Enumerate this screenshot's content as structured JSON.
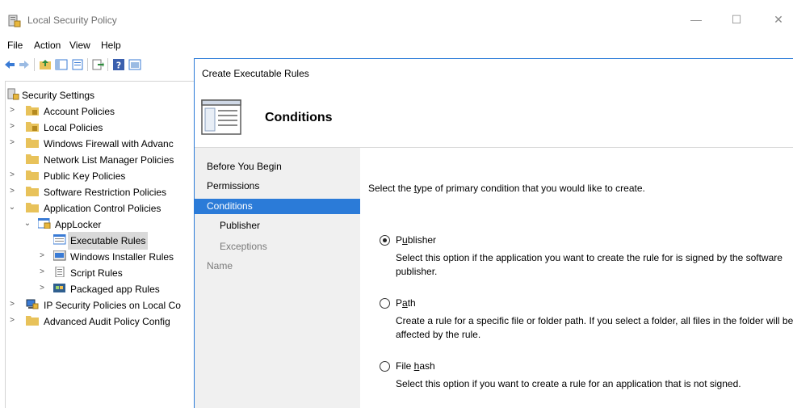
{
  "window": {
    "title": "Local Security Policy"
  },
  "menu": [
    "File",
    "Action",
    "View",
    "Help"
  ],
  "tree": {
    "items": [
      {
        "label": "Security Settings",
        "icon": "security-settings-icon",
        "expand": ""
      },
      {
        "label": "Account Policies",
        "icon": "folder-lock-icon",
        "expand": ">"
      },
      {
        "label": "Local Policies",
        "icon": "folder-lock-icon",
        "expand": ">"
      },
      {
        "label": "Windows Firewall with Advanc",
        "icon": "folder-icon",
        "expand": ">"
      },
      {
        "label": "Network List Manager Policies",
        "icon": "folder-icon",
        "expand": ""
      },
      {
        "label": "Public Key Policies",
        "icon": "folder-icon",
        "expand": ">"
      },
      {
        "label": "Software Restriction Policies",
        "icon": "folder-icon",
        "expand": ">"
      },
      {
        "label": "Application Control Policies",
        "icon": "folder-icon",
        "expand": "v"
      },
      {
        "label": "AppLocker",
        "icon": "applocker-icon",
        "expand": "v"
      },
      {
        "label": "Executable Rules",
        "icon": "rules-icon",
        "expand": ""
      },
      {
        "label": "Windows Installer Rules",
        "icon": "installer-icon",
        "expand": ">"
      },
      {
        "label": "Script Rules",
        "icon": "script-icon",
        "expand": ">"
      },
      {
        "label": "Packaged app Rules",
        "icon": "packaged-app-icon",
        "expand": ">"
      },
      {
        "label": "IP Security Policies on Local Co",
        "icon": "ip-security-icon",
        "expand": ">"
      },
      {
        "label": "Advanced Audit Policy Config",
        "icon": "folder-icon",
        "expand": ">"
      }
    ]
  },
  "dialog": {
    "title": "Create Executable Rules",
    "header": "Conditions",
    "nav": [
      {
        "label": "Before You Begin",
        "state": "normal"
      },
      {
        "label": "Permissions",
        "state": "normal"
      },
      {
        "label": "Conditions",
        "state": "active"
      },
      {
        "label": "Publisher",
        "state": "sub"
      },
      {
        "label": "Exceptions",
        "state": "sub-disabled"
      },
      {
        "label": "Name",
        "state": "disabled"
      }
    ],
    "prompt_pre": "Select the ",
    "prompt_key": "t",
    "prompt_post": "ype of primary condition that you would like to create.",
    "options": [
      {
        "pre": "P",
        "key": "u",
        "post": "blisher",
        "checked": true,
        "desc": "Select this option if the application you want to create the rule for is signed by the software publisher."
      },
      {
        "pre": "P",
        "key": "a",
        "post": "th",
        "checked": false,
        "desc": "Create a rule for a specific file or folder path. If you select a folder, all files in the folder will be affected by the rule."
      },
      {
        "pre": "File ",
        "key": "h",
        "post": "ash",
        "checked": false,
        "desc": "Select this option if you want to create a rule for an application that is not signed."
      }
    ]
  },
  "colors": {
    "accent": "#2b7bd8",
    "nav_bg": "#f0f0f0",
    "folder": "#e8c25a"
  }
}
